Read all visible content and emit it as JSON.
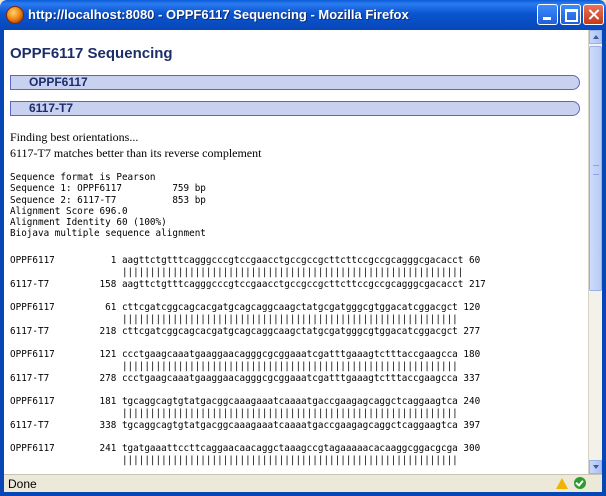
{
  "window": {
    "title": "http://localhost:8080 - OPPF6117 Sequencing - Mozilla Firefox"
  },
  "page": {
    "title": "OPPF6117 Sequencing",
    "bars": [
      "OPPF6117",
      "6117-T7"
    ],
    "messages": [
      "Finding best orientations...",
      "6117-T7 matches better than its reverse complement"
    ]
  },
  "alignment": {
    "meta": [
      "Sequence format is Pearson",
      "Sequence 1: OPPF6117         759 bp",
      "Sequence 2: 6117-T7          853 bp",
      "Alignment Score 696.0",
      "Alignment Identity 60 (100%)",
      "Biojava multiple sequence alignment"
    ],
    "blocks": [
      {
        "q_name": "OPPF6117",
        "q_start": 1,
        "q_seq": "aagttctgtttcagggcccgtccgaacctgccgccgcttcttccgccgcagggcgacacct",
        "q_end": 60,
        "s_name": "6117-T7",
        "s_start": 158,
        "s_seq": "aagttctgtttcagggcccgtccgaacctgccgccgcttcttccgccgcagggcgacacct",
        "s_end": 217
      },
      {
        "q_name": "OPPF6117",
        "q_start": 61,
        "q_seq": "cttcgatcggcagcacgatgcagcaggcaagctatgcgatgggcgtggacatcggacgct",
        "q_end": 120,
        "s_name": "6117-T7",
        "s_start": 218,
        "s_seq": "cttcgatcggcagcacgatgcagcaggcaagctatgcgatgggcgtggacatcggacgct",
        "s_end": 277
      },
      {
        "q_name": "OPPF6117",
        "q_start": 121,
        "q_seq": "ccctgaagcaaatgaaggaacagggcgcggaaatcgatttgaaagtctttaccgaagcca",
        "q_end": 180,
        "s_name": "6117-T7",
        "s_start": 278,
        "s_seq": "ccctgaagcaaatgaaggaacagggcgcggaaatcgatttgaaagtctttaccgaagcca",
        "s_end": 337
      },
      {
        "q_name": "OPPF6117",
        "q_start": 181,
        "q_seq": "tgcaggcagtgtatgacggcaaagaaatcaaaatgaccgaagagcaggctcaggaagtca",
        "q_end": 240,
        "s_name": "6117-T7",
        "s_start": 338,
        "s_seq": "tgcaggcagtgtatgacggcaaagaaatcaaaatgaccgaagagcaggctcaggaagtca",
        "s_end": 397
      },
      {
        "q_name": "OPPF6117",
        "q_start": 241,
        "q_seq": "tgatgaaattccttcaggaacaacaggctaaagccgtagaaaaacacaaggcggacgcga",
        "q_end": 300
      }
    ]
  },
  "status": {
    "text": "Done"
  }
}
